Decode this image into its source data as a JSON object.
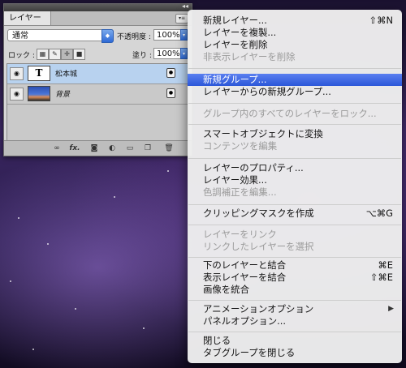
{
  "layers_panel": {
    "tab_label": "レイヤー",
    "blend_mode": "通常",
    "opacity_label": "不透明度 :",
    "opacity_value": "100%",
    "lock_label": "ロック :",
    "fill_label": "塗り :",
    "fill_value": "100%",
    "layers": [
      {
        "name": "松本城",
        "thumb": "T",
        "active": true
      },
      {
        "name": "背景",
        "thumb": "",
        "active": false
      }
    ],
    "footer_fx": "fx."
  },
  "context_menu": {
    "items": [
      {
        "label": "新規レイヤー...",
        "shortcut": "⇧⌘N",
        "disabled": false
      },
      {
        "label": "レイヤーを複製...",
        "shortcut": "",
        "disabled": false
      },
      {
        "label": "レイヤーを削除",
        "shortcut": "",
        "disabled": false
      },
      {
        "label": "非表示レイヤーを削除",
        "shortcut": "",
        "disabled": true
      },
      {
        "label": "新規グループ...",
        "shortcut": "",
        "disabled": false,
        "highlighted": true
      },
      {
        "label": "レイヤーからの新規グループ...",
        "shortcut": "",
        "disabled": false
      },
      {
        "label": "グループ内のすべてのレイヤーをロック...",
        "shortcut": "",
        "disabled": true
      },
      {
        "label": "スマートオブジェクトに変換",
        "shortcut": "",
        "disabled": false
      },
      {
        "label": "コンテンツを編集",
        "shortcut": "",
        "disabled": true
      },
      {
        "label": "レイヤーのプロパティ...",
        "shortcut": "",
        "disabled": false
      },
      {
        "label": "レイヤー効果...",
        "shortcut": "",
        "disabled": false
      },
      {
        "label": "色調補正を編集...",
        "shortcut": "",
        "disabled": true
      },
      {
        "label": "クリッピングマスクを作成",
        "shortcut": "⌥⌘G",
        "disabled": false
      },
      {
        "label": "レイヤーをリンク",
        "shortcut": "",
        "disabled": true
      },
      {
        "label": "リンクしたレイヤーを選択",
        "shortcut": "",
        "disabled": true
      },
      {
        "label": "下のレイヤーと結合",
        "shortcut": "⌘E",
        "disabled": false
      },
      {
        "label": "表示レイヤーを結合",
        "shortcut": "⇧⌘E",
        "disabled": false
      },
      {
        "label": "画像を統合",
        "shortcut": "",
        "disabled": false
      },
      {
        "label": "アニメーションオプション",
        "shortcut": "",
        "disabled": false,
        "submenu": true
      },
      {
        "label": "パネルオプション...",
        "shortcut": "",
        "disabled": false
      },
      {
        "label": "閉じる",
        "shortcut": "",
        "disabled": false
      },
      {
        "label": "タブグループを閉じる",
        "shortcut": "",
        "disabled": false
      }
    ]
  },
  "colors": {
    "highlight": "#2b57d8",
    "disabled_text": "#9b9b9b",
    "active_layer": "#b8d2ef"
  }
}
